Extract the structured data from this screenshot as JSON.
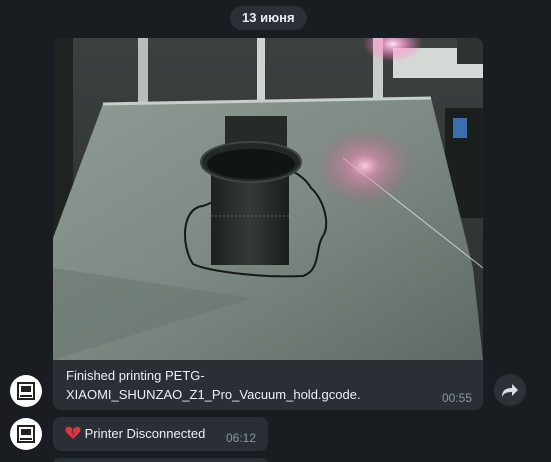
{
  "date_separator": "13 июня",
  "messages": [
    {
      "caption": "Finished printing PETG-XIAOMI_SHUNZAO_Z1_Pro_Vacuum_hold.gcode.",
      "time": "00:55"
    },
    {
      "text": "Printer Disconnected",
      "time": "06:12",
      "icon": "broken-heart-icon"
    }
  ],
  "colors": {
    "background": "#191c20",
    "bubble": "#2a2f36",
    "date_pill": "#2b3037",
    "text": "#ecf0f3",
    "time": "#8b949e"
  }
}
